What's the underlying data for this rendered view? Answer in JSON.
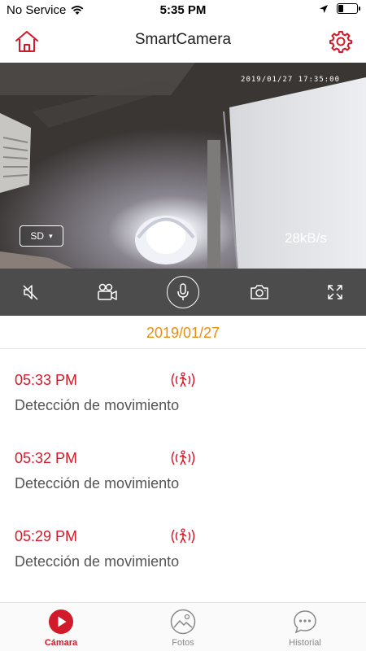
{
  "status_bar": {
    "carrier": "No Service",
    "time": "5:35 PM"
  },
  "header": {
    "title": "SmartCamera",
    "home_icon": "home-icon",
    "settings_icon": "gear-icon"
  },
  "video": {
    "osd_timestamp": "2019/01/27 17:35:00",
    "bitrate": "28kB/s",
    "quality": "SD"
  },
  "controls": {
    "icons": [
      "mute-icon",
      "record-video-icon",
      "microphone-icon",
      "camera-icon",
      "fullscreen-icon"
    ]
  },
  "events": {
    "date": "2019/01/27",
    "items": [
      {
        "time": "05:33 PM",
        "label": "Detección de movimiento"
      },
      {
        "time": "05:32 PM",
        "label": "Detección de movimiento"
      },
      {
        "time": "05:29 PM",
        "label": "Detección de movimiento"
      }
    ]
  },
  "tabs": [
    {
      "label": "Cámara",
      "icon": "play-icon",
      "active": true
    },
    {
      "label": "Fotos",
      "icon": "photos-icon",
      "active": false
    },
    {
      "label": "Historial",
      "icon": "chat-icon",
      "active": false
    }
  ],
  "colors": {
    "accent": "#d11a2a",
    "date": "#e8900c",
    "controls_bg": "#4c4c4c"
  }
}
